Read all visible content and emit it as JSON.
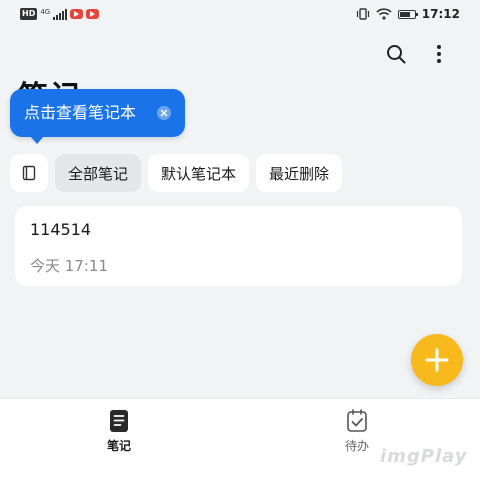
{
  "status_bar": {
    "hd": "HD",
    "network": "4G",
    "time": "17:12"
  },
  "header": {
    "title": "笔记",
    "search_icon": "search-icon",
    "more_icon": "more-vertical-icon"
  },
  "tooltip": {
    "text": "点击查看笔记本",
    "close_icon": "close-icon"
  },
  "tabs": [
    {
      "icon": "notebook-icon"
    },
    {
      "label": "全部笔记",
      "active": true
    },
    {
      "label": "默认笔记本"
    },
    {
      "label": "最近删除"
    }
  ],
  "notes": [
    {
      "title": "114514",
      "time": "今天 17:11"
    }
  ],
  "fab": {
    "icon": "plus-icon"
  },
  "bottom_nav": [
    {
      "label": "笔记",
      "icon": "note-icon",
      "active": true
    },
    {
      "label": "待办",
      "icon": "todo-icon",
      "active": false
    }
  ],
  "watermark": "imgPlay",
  "colors": {
    "accent_blue": "#1a73e8",
    "fab_yellow": "#f8b91c",
    "background": "#f1f3f5"
  }
}
